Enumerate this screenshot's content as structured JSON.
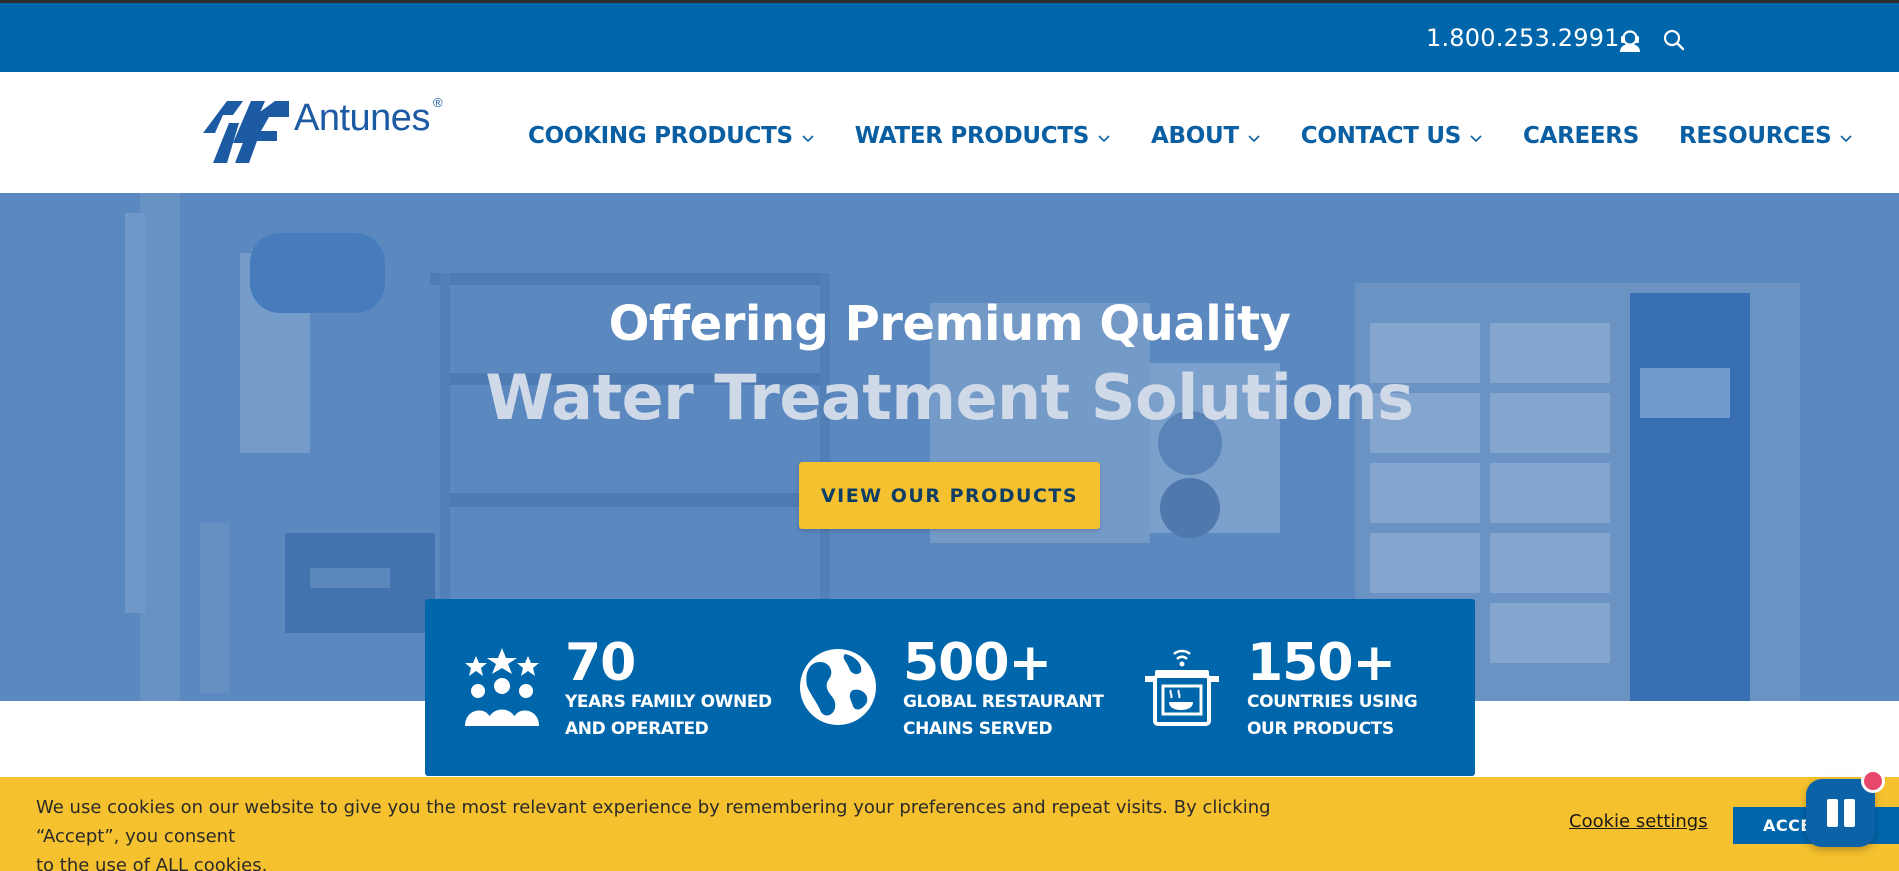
{
  "topbar": {
    "phone": "1.800.253.2991",
    "support_icon": "headset-support-icon",
    "search_icon": "search-icon"
  },
  "header": {
    "logo_text": "Antunes",
    "logo_reg": "®",
    "nav": [
      {
        "label": "COOKING PRODUCTS",
        "has_dropdown": true
      },
      {
        "label": "WATER PRODUCTS",
        "has_dropdown": true
      },
      {
        "label": "ABOUT",
        "has_dropdown": true
      },
      {
        "label": "CONTACT US",
        "has_dropdown": true
      },
      {
        "label": "CAREERS",
        "has_dropdown": false
      },
      {
        "label": "RESOURCES",
        "has_dropdown": true
      }
    ]
  },
  "hero": {
    "title": "Offering Premium Quality",
    "subtitle": "Water Treatment Solutions",
    "cta_label": "VIEW OUR PRODUCTS"
  },
  "stats": [
    {
      "number": "70",
      "line1": "YEARS FAMILY OWNED",
      "line2": "AND OPERATED",
      "icon": "family-stars-icon"
    },
    {
      "number": "500+",
      "line1": "GLOBAL RESTAURANT",
      "line2": "CHAINS SERVED",
      "icon": "globe-icon"
    },
    {
      "number": "150+",
      "line1": "COUNTRIES USING",
      "line2": "OUR PRODUCTS",
      "icon": "smart-cooker-icon"
    }
  ],
  "cookie": {
    "message_line1": "We use cookies on our website to give you the most relevant experience by remembering your preferences and repeat visits. By clicking “Accept”, you consent",
    "message_line2": "to the use of ALL cookies.",
    "settings_label": "Cookie settings",
    "accept_label": "ACCEPT"
  },
  "chat": {
    "icon": "chat-widget-icon"
  },
  "colors": {
    "brand_blue": "#0066ab",
    "accent_yellow": "#f5c12e",
    "hero_blue": "#6b96c8"
  }
}
